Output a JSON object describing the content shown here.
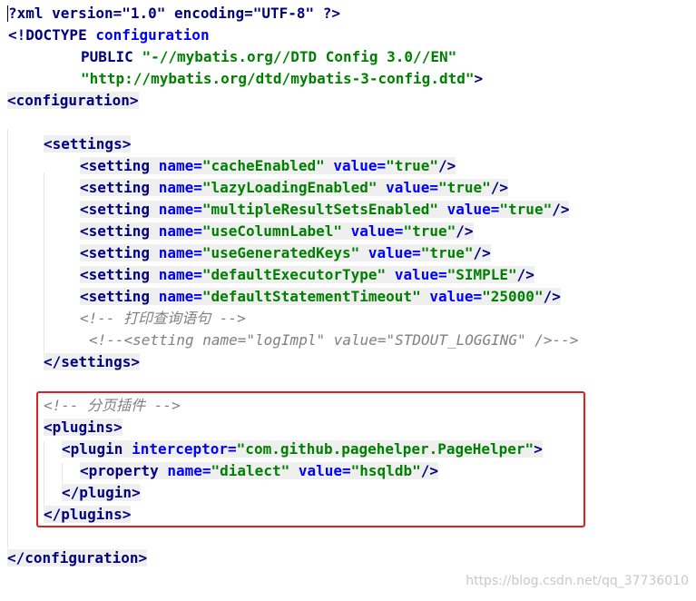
{
  "code": {
    "xml_decl": "?xml version=\"1.0\" encoding=\"UTF-8\" ?>",
    "doctype_open": "<!DOCTYPE",
    "doctype_name": "configuration",
    "public_kw": "PUBLIC",
    "public_id": "\"-//mybatis.org//DTD Config 3.0//EN\"",
    "system_id": "\"http://mybatis.org/dtd/mybatis-3-config.dtd\"",
    "configuration_open": "<configuration>",
    "settings_open": "<settings>",
    "settings_close": "</settings>",
    "setting_tag": "<setting",
    "name_attr": "name=",
    "value_attr": "value=",
    "self_close": "/>",
    "settings": [
      {
        "name": "\"cacheEnabled\"",
        "value": "\"true\""
      },
      {
        "name": "\"lazyLoadingEnabled\"",
        "value": "\"true\""
      },
      {
        "name": "\"multipleResultSetsEnabled\"",
        "value": "\"true\""
      },
      {
        "name": "\"useColumnLabel\"",
        "value": "\"true\""
      },
      {
        "name": "\"useGeneratedKeys\"",
        "value": "\"true\""
      },
      {
        "name": "\"defaultExecutorType\"",
        "value": "\"SIMPLE\""
      },
      {
        "name": "\"defaultStatementTimeout\"",
        "value": "\"25000\""
      }
    ],
    "comment_print_sql": "<!-- 打印查询语句 -->",
    "comment_log_impl": "<!--<setting name=\"logImpl\" value=\"STDOUT_LOGGING\" />-->",
    "comment_plugins": "<!-- 分页插件 -->",
    "plugins_open": "<plugins>",
    "plugin_tag": "<plugin",
    "interceptor_attr": "interceptor=",
    "interceptor_value": "\"com.github.pagehelper.PageHelper\"",
    "close_angle": ">",
    "property_tag": "<property",
    "property_name": "\"dialect\"",
    "property_value": "\"hsqldb\"",
    "plugin_close": "</plugin>",
    "plugins_close": "</plugins>",
    "configuration_close": "</configuration>"
  },
  "watermark": "https://blog.csdn.net/qq_37736010",
  "colors": {
    "tag": "#000080",
    "attribute": "#0000ff",
    "value": "#008000",
    "comment": "#808080",
    "highlight_box": "#e02020"
  }
}
